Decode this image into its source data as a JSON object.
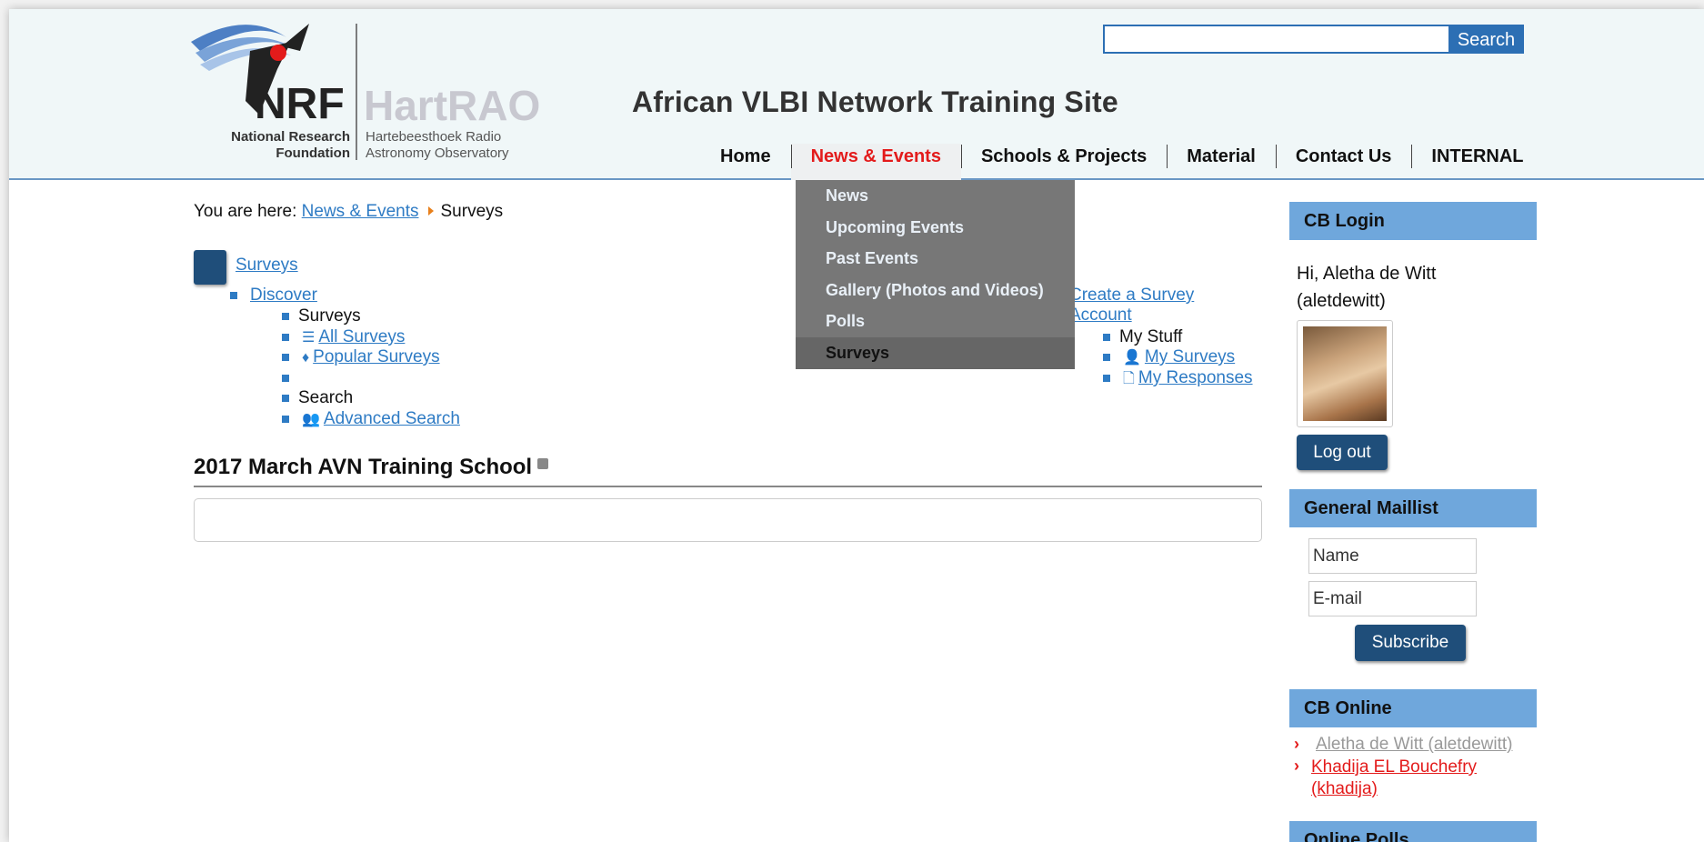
{
  "header": {
    "logo": {
      "nrf": "NRF",
      "nrf_line1": "National Research",
      "nrf_line2": "Foundation",
      "hartrao": "HartRAO",
      "hartrao_line1": "Hartebeesthoek Radio",
      "hartrao_line2": "Astronomy Observatory"
    },
    "site_title": "African VLBI Network Training Site",
    "search": {
      "value": "",
      "button_label": "Search"
    },
    "nav": [
      {
        "label": "Home",
        "active": false
      },
      {
        "label": "News & Events",
        "active": true
      },
      {
        "label": "Schools & Projects",
        "active": false
      },
      {
        "label": "Material",
        "active": false
      },
      {
        "label": "Contact Us",
        "active": false
      },
      {
        "label": "INTERNAL",
        "active": false
      }
    ],
    "dropdown": [
      "News",
      "Upcoming Events",
      "Past Events",
      "Gallery (Photos and Videos)",
      "Polls",
      "Surveys"
    ]
  },
  "breadcrumb": {
    "prefix": "You are here:",
    "link": "News & Events",
    "current": "Surveys"
  },
  "surveys_menu": {
    "title": "Surveys",
    "discover": "Discover",
    "surveys_label": "Surveys",
    "all_surveys": "All Surveys",
    "popular_surveys": "Popular Surveys",
    "search_label": "Search",
    "advanced_search": "Advanced Search",
    "create_account": "Create a Survey Account",
    "my_stuff": "My Stuff",
    "my_surveys": "My Surveys",
    "my_responses": "My Responses"
  },
  "content": {
    "heading": "2017 March AVN Training School"
  },
  "sidebar": {
    "login": {
      "title": "CB Login",
      "greeting_line1": "Hi, Aletha de Witt",
      "greeting_line2": "(aletdewitt)",
      "logout_label": "Log out"
    },
    "maillist": {
      "title": "General Maillist",
      "name_value": "Name",
      "email_value": "E-mail",
      "subscribe_label": "Subscribe"
    },
    "online": {
      "title": "CB Online",
      "users": [
        "Aletha de Witt (aletdewitt)",
        "Khadija EL Bouchefry (khadija)"
      ]
    },
    "polls": {
      "title": "Online Polls"
    }
  },
  "colors": {
    "accent": "#2c6fb4",
    "nav_active": "#e31b1b",
    "sidebar_head": "#6fa7dc",
    "button_dark": "#1f4e7a"
  }
}
